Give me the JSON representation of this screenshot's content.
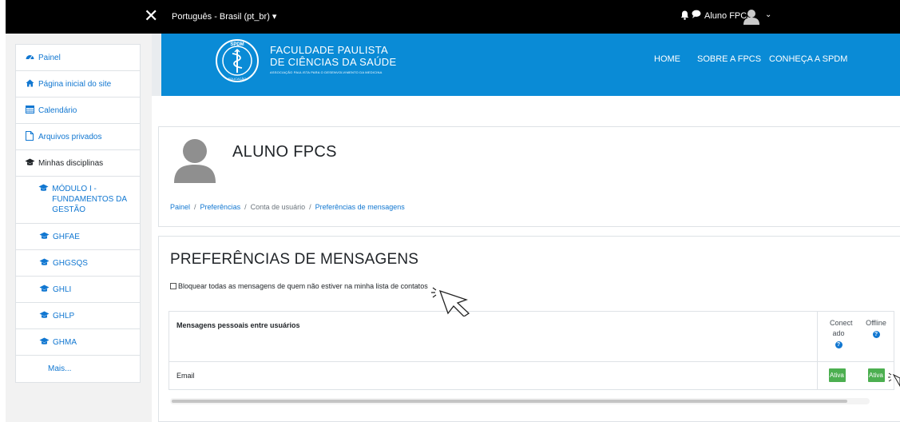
{
  "topbar": {
    "close_glyph": "✕",
    "language": "Português - Brasil (pt_br) ▾",
    "user_name": "Aluno FPCS",
    "caret": "⌄",
    "icons": [
      "close-icon",
      "bell-icon",
      "chat-icon",
      "avatar",
      "chevron-down-icon"
    ]
  },
  "nav": {
    "items": [
      {
        "label": "Painel",
        "icon": "dashboard-icon"
      },
      {
        "label": "Página inicial do site",
        "icon": "home-icon"
      },
      {
        "label": "Calendário",
        "icon": "calendar-icon"
      },
      {
        "label": "Arquivos privados",
        "icon": "file-icon"
      },
      {
        "label": "Minhas disciplinas",
        "icon": "graduation-cap-icon"
      }
    ],
    "courses": [
      {
        "label": "MÓDULO I - FUNDAMENTOS DA GESTÃO"
      },
      {
        "label": "GHFAE"
      },
      {
        "label": "GHGSQS"
      },
      {
        "label": "GHLI"
      },
      {
        "label": "GHLP"
      },
      {
        "label": "GHMA"
      }
    ],
    "more": "Mais..."
  },
  "brand": {
    "name_line1": "FACULDADE PAULISTA",
    "name_line2": "DE CIÊNCIAS DA SAÚDE",
    "tagline": "ASSOCIAÇÃO PAULISTA PARA O DESENVOLVIMENTO DA MEDICINA",
    "logo_top": "SPDM",
    "logo_bottom": "EDUCAÇÃO",
    "menu": [
      "HOME",
      "SOBRE A FPCS",
      "CONHEÇA A SPDM"
    ],
    "color": "#0a8bd6"
  },
  "profile": {
    "name": "ALUNO FPCS",
    "breadcrumb": [
      "Painel",
      "Preferências",
      "Conta de usuário",
      "Preferências de mensagens"
    ],
    "separator": "/"
  },
  "preferences": {
    "title": "PREFERÊNCIAS DE MENSAGENS",
    "block_label": "Bloquear todas as mensagens de quem não estiver na minha lista de contatos",
    "block_checked": false,
    "table": {
      "section_header": "Mensagens pessoais entre usuários",
      "col_online": "Conect ado",
      "col_offline": "Offline",
      "help_glyph": "?",
      "rows": [
        {
          "label": "Email",
          "online": "Ativa",
          "offline": "Ativa"
        }
      ]
    }
  },
  "colors": {
    "link": "#1177d1",
    "toggle_on": "#4caf50"
  }
}
